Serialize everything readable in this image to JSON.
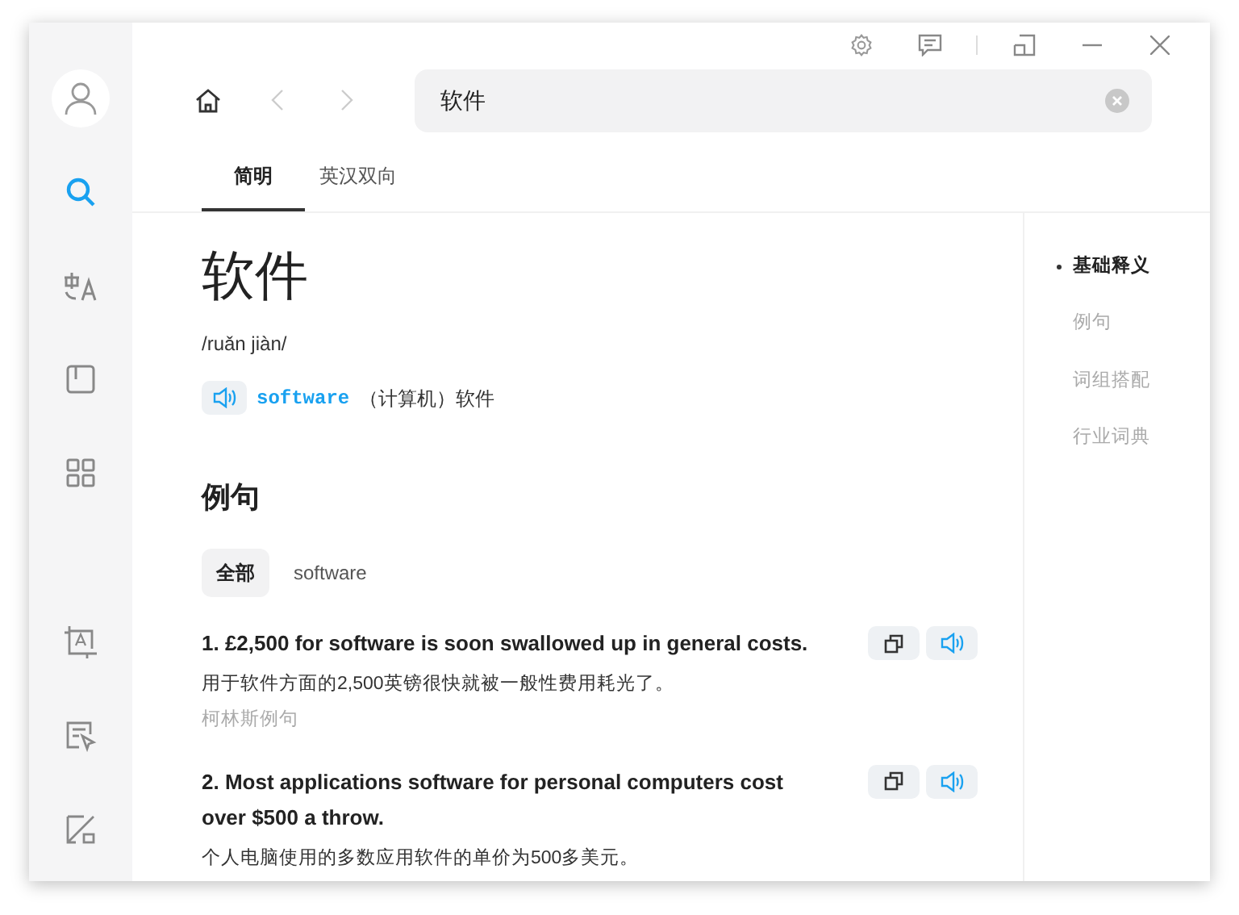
{
  "sidebar": {
    "items": [
      {
        "kind": "search",
        "selected": true
      },
      {
        "kind": "translate",
        "selected": false
      },
      {
        "kind": "book",
        "selected": false
      },
      {
        "kind": "grid",
        "selected": false
      }
    ],
    "bottom_items": [
      {
        "kind": "image-text"
      },
      {
        "kind": "doc"
      },
      {
        "kind": "edit"
      }
    ]
  },
  "search": {
    "value": "软件"
  },
  "tabs": [
    {
      "label": "简明",
      "selected": true
    },
    {
      "label": "英汉双向",
      "selected": false
    }
  ],
  "entry": {
    "headword": "软件",
    "pinyin": "/ruǎn jiàn/",
    "translations": [
      {
        "word": "software",
        "meaning": "（计算机）软件"
      }
    ]
  },
  "examples": {
    "heading": "例句",
    "filters": [
      {
        "label": "全部",
        "selected": true
      },
      {
        "label": "software",
        "selected": false
      }
    ],
    "items": [
      {
        "en": "1. £2,500 for software is soon swallowed up in general costs.",
        "zh": "用于软件方面的2,500英镑很快就被一般性费用耗光了。",
        "source": "柯林斯例句"
      },
      {
        "en": "2. Most applications software for personal computers cost over $500 a throw.",
        "zh": "个人电脑使用的多数应用软件的单价为500多美元。"
      }
    ]
  },
  "outline": [
    {
      "label": "基础释义",
      "selected": true
    },
    {
      "label": "例句",
      "selected": false
    },
    {
      "label": "词组搭配",
      "selected": false
    },
    {
      "label": "行业词典",
      "selected": false
    }
  ]
}
